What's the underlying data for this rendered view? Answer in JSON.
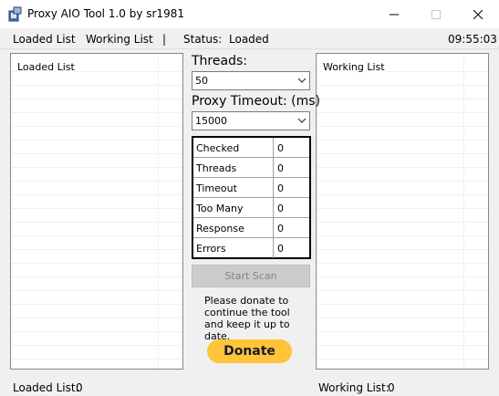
{
  "window": {
    "title": "Proxy AIO Tool 1.0 by sr1981"
  },
  "menu": {
    "loaded_list": "Loaded List",
    "working_list": "Working List",
    "separator": "|",
    "status_label": "Status:",
    "status_value": "Loaded",
    "clock": "09:55:03"
  },
  "left_panel": {
    "title": "Loaded List"
  },
  "right_panel": {
    "title": "Working List"
  },
  "threads": {
    "label": "Threads:",
    "value": "50"
  },
  "timeout": {
    "label": "Proxy Timeout: (ms)",
    "value": "15000"
  },
  "stats": [
    {
      "name": "Checked",
      "value": "0"
    },
    {
      "name": "Threads",
      "value": "0"
    },
    {
      "name": "Timeout",
      "value": "0"
    },
    {
      "name": "Too Many",
      "value": "0"
    },
    {
      "name": "Response",
      "value": "0"
    },
    {
      "name": "Errors",
      "value": "0"
    }
  ],
  "buttons": {
    "start_scan": "Start Scan",
    "donate": "Donate"
  },
  "donate_message": "Please donate to continue the tool and keep it up to date.",
  "status_bar": {
    "loaded_label": "Loaded List:",
    "loaded_count": "0",
    "working_label": "Working List:",
    "working_count": "0"
  },
  "icons": {
    "app": "app-icon",
    "dropdown": "chevron-down-icon"
  },
  "colors": {
    "donate": "#ffc439",
    "disabled_button": "#cccccc",
    "titlebar": "#ffffff"
  }
}
